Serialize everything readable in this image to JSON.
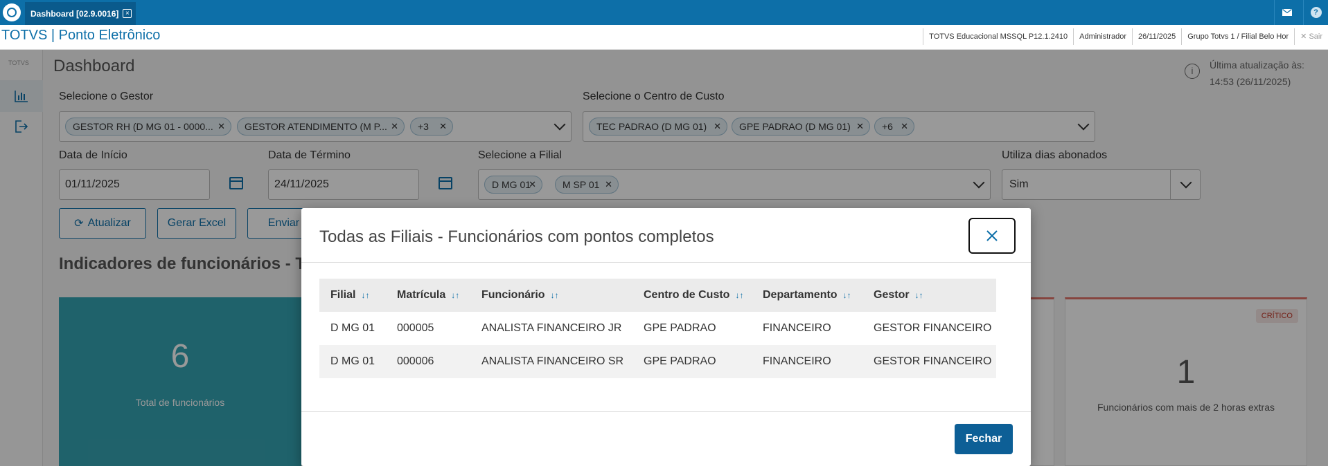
{
  "tabbar": {
    "tab_label": "Dashboard [02.9.0016]",
    "tab_close": "×"
  },
  "header": {
    "app_title": "TOTVS | Ponto Eletrônico",
    "environment": "TOTVS Educacional MSSQL P12.1.2410",
    "user": "Administrador",
    "date": "26/11/2025",
    "branch": "Grupo Totvs 1 / Filial Belo Hor",
    "exit": "Sair"
  },
  "sidebar": {
    "logo_text": "TOTVS"
  },
  "dashboard": {
    "title": "Dashboard",
    "last_update_label": "Última atualização às:",
    "last_update_value": "14:53 (26/11/2025)",
    "gestor_label": "Selecione o Gestor",
    "gestor_chips": [
      "GESTOR RH (D MG 01 - 0000...",
      "GESTOR ATENDIMENTO (M P...",
      "+3"
    ],
    "centro_label": "Selecione o Centro de Custo",
    "centro_chips": [
      "TEC PADRAO (D MG 01)",
      "GPE PADRAO (D MG 01)",
      "+6"
    ],
    "data_inicio_label": "Data de Início",
    "data_inicio_value": "01/11/2025",
    "data_termino_label": "Data de Término",
    "data_termino_value": "24/11/2025",
    "filial_label": "Selecione a Filial",
    "filial_chips": [
      "D MG 01",
      "M SP 01"
    ],
    "abonados_label": "Utiliza dias abonados",
    "abonados_value": "Sim",
    "btn_atualizar": "Atualizar",
    "btn_excel": "Gerar Excel",
    "btn_enviar": "Enviar E",
    "section_title": "Indicadores de funcionários - Toc",
    "card_total_value": "6",
    "card_total_label": "Total de funcionários",
    "card_extra_badge": "CRÍTICO",
    "card_extra_value": "1",
    "card_extra_label": "Funcionários com mais de 2 horas extras"
  },
  "modal": {
    "title": "Todas as Filiais - Funcionários com pontos completos",
    "columns": [
      "Filial",
      "Matrícula",
      "Funcionário",
      "Centro de Custo",
      "Departamento",
      "Gestor"
    ],
    "rows": [
      [
        "D MG 01",
        "000005",
        "ANALISTA FINANCEIRO JR",
        "GPE PADRAO",
        "FINANCEIRO",
        "GESTOR FINANCEIRO"
      ],
      [
        "D MG 01",
        "000006",
        "ANALISTA FINANCEIRO SR",
        "GPE PADRAO",
        "FINANCEIRO",
        "GESTOR FINANCEIRO"
      ]
    ],
    "close_button": "Fechar"
  },
  "colors": {
    "brand_blue": "#0d6fa8",
    "teal_card": "#35a3b3",
    "critical": "#c0392b"
  }
}
